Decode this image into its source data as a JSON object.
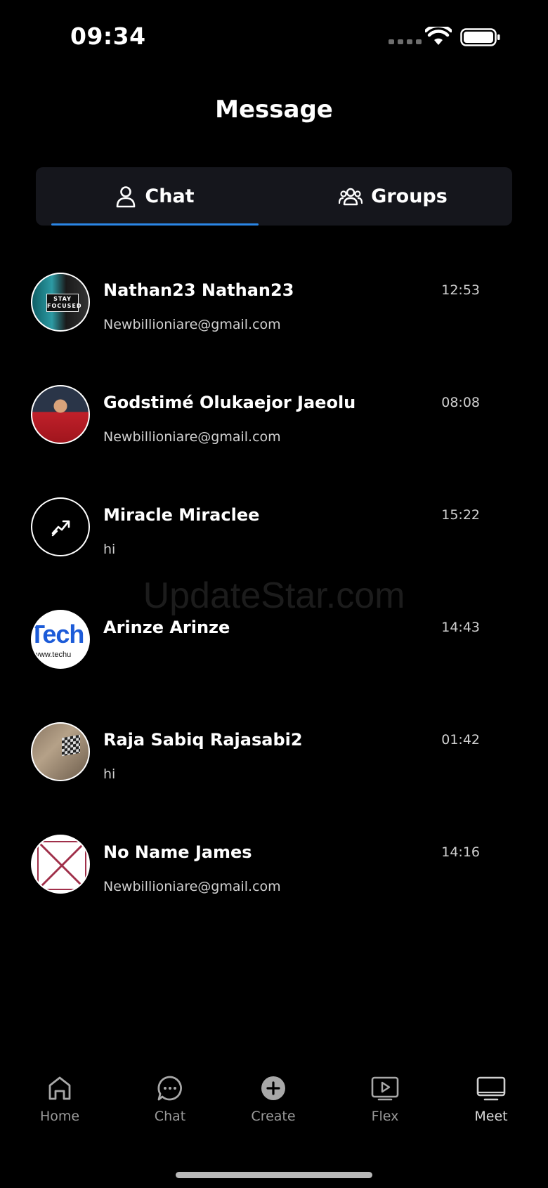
{
  "status_bar": {
    "time": "09:34"
  },
  "header": {
    "title": "Message"
  },
  "tabs": [
    {
      "label": "Chat",
      "icon": "person-icon",
      "active": true
    },
    {
      "label": "Groups",
      "icon": "group-icon",
      "active": false
    }
  ],
  "chats": [
    {
      "name": "Nathan23 Nathan23",
      "preview": "Newbillioniare@gmail.com",
      "time": "12:53",
      "avatar_text": "STAY FOCUSED"
    },
    {
      "name": "Godstimé Olukaejor Jaeolu",
      "preview": "Newbillioniare@gmail.com",
      "time": "08:08"
    },
    {
      "name": "Miracle Miraclee",
      "preview": "hi",
      "time": "15:22"
    },
    {
      "name": "Arinze Arinze",
      "preview": "",
      "time": "14:43",
      "avatar_text": "Tech",
      "avatar_subtext": "www.techu"
    },
    {
      "name": "Raja Sabiq Rajasabi2",
      "preview": "hi",
      "time": "01:42"
    },
    {
      "name": "No Name James",
      "preview": "Newbillioniare@gmail.com",
      "time": "14:16"
    }
  ],
  "watermark": "UpdateStar.com",
  "bottom_nav": [
    {
      "label": "Home",
      "icon": "home-icon"
    },
    {
      "label": "Chat",
      "icon": "chat-bubble-icon"
    },
    {
      "label": "Create",
      "icon": "plus-circle-icon"
    },
    {
      "label": "Flex",
      "icon": "play-screen-icon"
    },
    {
      "label": "Meet",
      "icon": "monitor-icon"
    }
  ],
  "colors": {
    "background": "#000000",
    "tab_bar": "#15161c",
    "accent": "#2b86e6"
  }
}
